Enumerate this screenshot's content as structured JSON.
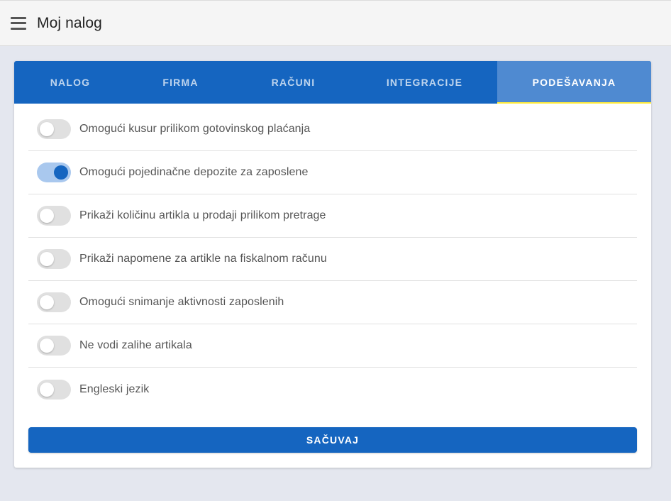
{
  "header": {
    "title": "Moj nalog",
    "menu_icon": "hamburger-menu-icon"
  },
  "tabs": [
    {
      "label": "NALOG",
      "active": false
    },
    {
      "label": "FIRMA",
      "active": false
    },
    {
      "label": "RAČUNI",
      "active": false
    },
    {
      "label": "INTEGRACIJE",
      "active": false
    },
    {
      "label": "PODEŠAVANJA",
      "active": true
    }
  ],
  "settings": [
    {
      "label": "Omogući kusur prilikom gotovinskog plaćanja",
      "enabled": false
    },
    {
      "label": "Omogući pojedinačne depozite za zaposlene",
      "enabled": true
    },
    {
      "label": "Prikaži količinu artikla u prodaji prilikom pretrage",
      "enabled": false
    },
    {
      "label": "Prikaži napomene za artikle na fiskalnom računu",
      "enabled": false
    },
    {
      "label": "Omogući snimanje aktivnosti zaposlenih",
      "enabled": false
    },
    {
      "label": "Ne vodi zalihe artikala",
      "enabled": false
    },
    {
      "label": "Engleski jezik",
      "enabled": false
    }
  ],
  "save_label": "SAČUVAJ",
  "colors": {
    "primary": "#1565c0",
    "active_tab": "#4f8ad1",
    "tab_indicator": "#ffeb3b",
    "background": "#e4e7ef"
  }
}
